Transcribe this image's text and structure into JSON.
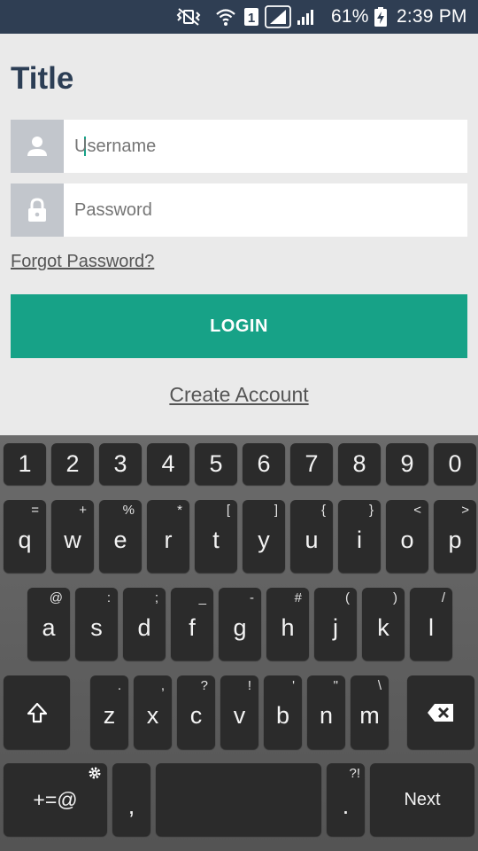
{
  "status_bar": {
    "battery_percent": "61%",
    "time": "2:39 PM",
    "sim_slot": "1",
    "icons": [
      "vibrate-icon",
      "wifi-icon",
      "sim-icon",
      "signal-icon",
      "signal-icon",
      "battery-charging-icon"
    ]
  },
  "app": {
    "title": "Title",
    "username_placeholder": "Username",
    "password_placeholder": "Password",
    "forgot_password": "Forgot Password?",
    "login_button": "LOGIN",
    "create_account": "Create Account",
    "accent_color": "#17a287",
    "title_color": "#2c3e55"
  },
  "keyboard": {
    "number_row": [
      "1",
      "2",
      "3",
      "4",
      "5",
      "6",
      "7",
      "8",
      "9",
      "0"
    ],
    "row1": [
      {
        "main": "q",
        "sec": "="
      },
      {
        "main": "w",
        "sec": "+"
      },
      {
        "main": "e",
        "sec": "%"
      },
      {
        "main": "r",
        "sec": "*"
      },
      {
        "main": "t",
        "sec": "["
      },
      {
        "main": "y",
        "sec": "]"
      },
      {
        "main": "u",
        "sec": "{"
      },
      {
        "main": "i",
        "sec": "}"
      },
      {
        "main": "o",
        "sec": "<"
      },
      {
        "main": "p",
        "sec": ">"
      }
    ],
    "row2": [
      {
        "main": "a",
        "sec": "@"
      },
      {
        "main": "s",
        "sec": ":"
      },
      {
        "main": "d",
        "sec": ";"
      },
      {
        "main": "f",
        "sec": "_"
      },
      {
        "main": "g",
        "sec": "-"
      },
      {
        "main": "h",
        "sec": "#"
      },
      {
        "main": "j",
        "sec": "("
      },
      {
        "main": "k",
        "sec": ")"
      },
      {
        "main": "l",
        "sec": "/"
      }
    ],
    "row3": [
      {
        "main": "z",
        "sec": "."
      },
      {
        "main": "x",
        "sec": ","
      },
      {
        "main": "c",
        "sec": "?"
      },
      {
        "main": "v",
        "sec": "!"
      },
      {
        "main": "b",
        "sec": "'"
      },
      {
        "main": "n",
        "sec": "\""
      },
      {
        "main": "m",
        "sec": "\\"
      }
    ],
    "symbols_key": "+=@",
    "comma_key": ",",
    "period_key": ".",
    "period_sec": "?!",
    "next_key": "Next"
  }
}
